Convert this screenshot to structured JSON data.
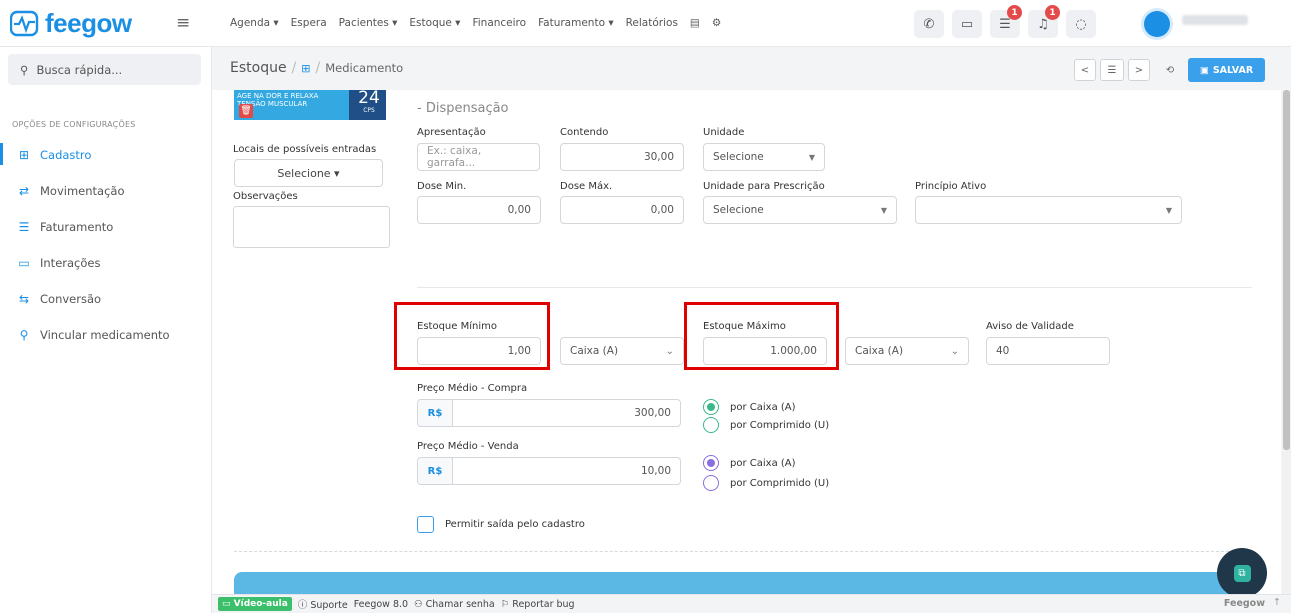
{
  "app": {
    "logo_text": "feegow",
    "brand_color": "#1a8fe3",
    "nav": [
      "Agenda ▾",
      "Espera",
      "Pacientes ▾",
      "Estoque ▾",
      "Financeiro",
      "Faturamento ▾",
      "Relatórios",
      "▤",
      "⚙"
    ],
    "badges": {
      "tasks": "1",
      "notifications": "1"
    }
  },
  "sidebar": {
    "search_placeholder": "Busca rápida...",
    "section_title": "OPÇÕES DE CONFIGURAÇÕES",
    "items": [
      {
        "label": "Cadastro",
        "icon": "add-box-icon",
        "glyph": "⊞"
      },
      {
        "label": "Movimentação",
        "icon": "swap-arrows-icon",
        "glyph": "⇄"
      },
      {
        "label": "Faturamento",
        "icon": "list-icon",
        "glyph": "☰"
      },
      {
        "label": "Interações",
        "icon": "folder-icon",
        "glyph": "▭"
      },
      {
        "label": "Conversão",
        "icon": "convert-icon",
        "glyph": "⇆"
      },
      {
        "label": "Vincular medicamento",
        "icon": "link-icon",
        "glyph": "⚲"
      }
    ]
  },
  "breadcrumb": {
    "root": "Estoque",
    "current": "Medicamento"
  },
  "toolbar": {
    "save_label": "SALVAR",
    "prev": "<",
    "list": "☰",
    "next": ">",
    "history": "⟲"
  },
  "promo": {
    "left_text": "AGE NA DOR E RELAXA TENSÃO MUSCULAR",
    "number": "24",
    "unit": "CPS"
  },
  "left_form": {
    "locais_label": "Locais de possíveis entradas",
    "locais_value": "Selecione ▾",
    "obs_label": "Observações"
  },
  "dispensacao": {
    "title": "- Dispensação",
    "apresentacao_label": "Apresentação",
    "apresentacao_placeholder": "Ex.: caixa, garrafa...",
    "contendo_label": "Contendo",
    "contendo_value": "30,00",
    "unidade_label": "Unidade",
    "unidade_value": "Selecione",
    "dose_min_label": "Dose Min.",
    "dose_min_value": "0,00",
    "dose_max_label": "Dose Máx.",
    "dose_max_value": "0,00",
    "unidade_prescricao_label": "Unidade para Prescrição",
    "unidade_prescricao_value": "Selecione",
    "principio_label": "Princípio Ativo",
    "principio_value": ""
  },
  "estoque": {
    "min_label": "Estoque Mínimo",
    "min_value": "1,00",
    "min_unit": "Caixa (A)",
    "max_label": "Estoque Máximo",
    "max_value": "1.000,00",
    "max_unit": "Caixa (A)",
    "validade_label": "Aviso de Validade",
    "validade_value": "40"
  },
  "precos": {
    "compra_label": "Preço Médio - Compra",
    "compra_prefix": "R$",
    "compra_value": "300,00",
    "compra_options": [
      "por Caixa (A)",
      "por Comprimido (U)"
    ],
    "compra_color": "#39b98a",
    "venda_label": "Preço Médio - Venda",
    "venda_prefix": "R$",
    "venda_value": "10,00",
    "venda_options": [
      "por Caixa (A)",
      "por Comprimido (U)"
    ],
    "venda_color": "#8a6de0"
  },
  "permitir_label": "Permitir saída pelo cadastro",
  "footer": {
    "video": "Vídeo-aula",
    "suporte": "ⓘ Suporte",
    "version": "Feegow 8.0",
    "chamar": "⚇ Chamar senha",
    "bug": "⚐ Reportar bug",
    "brand": "Feegow",
    "up": "↑"
  }
}
